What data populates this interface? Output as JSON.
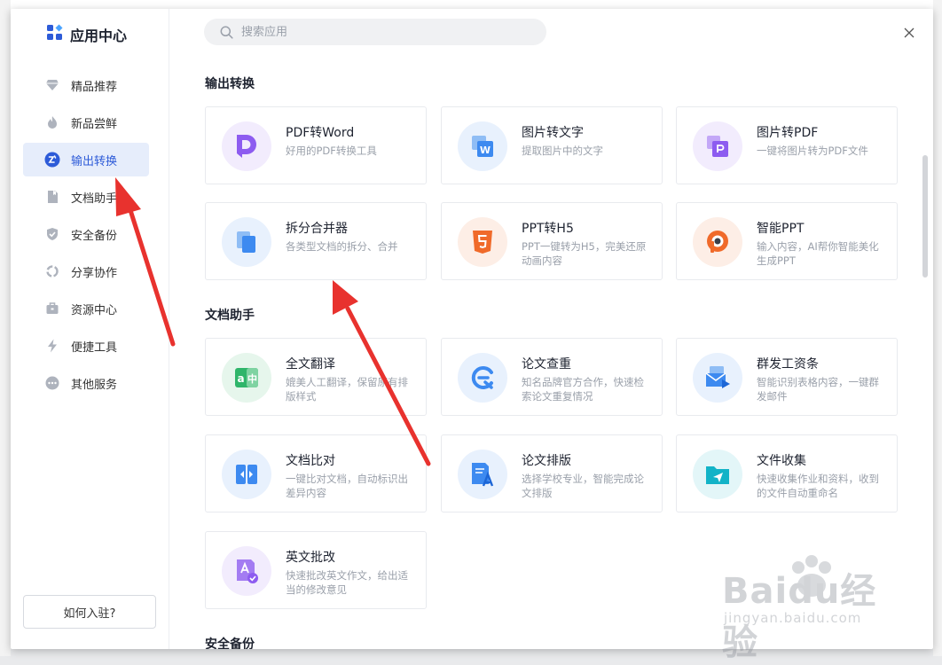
{
  "app": {
    "title": "应用中心"
  },
  "search": {
    "placeholder": "搜索应用"
  },
  "sidebar": {
    "items": [
      {
        "label": "精品推荐",
        "icon": "diamond-icon"
      },
      {
        "label": "新品尝鲜",
        "icon": "flame-icon"
      },
      {
        "label": "输出转换",
        "icon": "convert-icon",
        "active": true
      },
      {
        "label": "文档助手",
        "icon": "document-icon"
      },
      {
        "label": "安全备份",
        "icon": "shield-icon"
      },
      {
        "label": "分享协作",
        "icon": "share-icon"
      },
      {
        "label": "资源中心",
        "icon": "briefcase-icon"
      },
      {
        "label": "便捷工具",
        "icon": "lightning-icon"
      },
      {
        "label": "其他服务",
        "icon": "more-icon"
      }
    ],
    "join_label": "如何入驻?"
  },
  "sections": [
    {
      "title": "输出转换",
      "apps": [
        {
          "title": "PDF转Word",
          "desc": "好用的PDF转换工具",
          "icon": "pdf-to-word-icon"
        },
        {
          "title": "图片转文字",
          "desc": "提取图片中的文字",
          "icon": "image-to-text-icon"
        },
        {
          "title": "图片转PDF",
          "desc": "一键将图片转为PDF文件",
          "icon": "image-to-pdf-icon"
        },
        {
          "title": "拆分合并器",
          "desc": "各类型文档的拆分、合并",
          "icon": "split-merge-icon"
        },
        {
          "title": "PPT转H5",
          "desc": "PPT一键转为H5，完美还原动画内容",
          "icon": "html5-icon"
        },
        {
          "title": "智能PPT",
          "desc": "输入内容，AI帮你智能美化生成PPT",
          "icon": "smart-ppt-icon"
        }
      ]
    },
    {
      "title": "文档助手",
      "apps": [
        {
          "title": "全文翻译",
          "desc": "媲美人工翻译，保留原有排版样式",
          "icon": "translate-icon"
        },
        {
          "title": "论文查重",
          "desc": "知名品牌官方合作，快速检索论文重复情况",
          "icon": "plagiarism-check-icon"
        },
        {
          "title": "群发工资条",
          "desc": "智能识别表格内容，一键群发邮件",
          "icon": "payslip-mail-icon"
        },
        {
          "title": "文档比对",
          "desc": "一键比对文档，自动标识出差异内容",
          "icon": "compare-icon"
        },
        {
          "title": "论文排版",
          "desc": "选择学校专业，智能完成论文排版",
          "icon": "thesis-format-icon"
        },
        {
          "title": "文件收集",
          "desc": "快速收集作业和资料，收到的文件自动重命名",
          "icon": "file-collect-icon"
        },
        {
          "title": "英文批改",
          "desc": "快速批改英文作文，给出适当的修改意见",
          "icon": "english-correct-icon"
        }
      ]
    },
    {
      "title": "安全备份",
      "apps": []
    }
  ],
  "watermark": {
    "brand": "Baidu经验",
    "url": "jingyan.baidu.com"
  },
  "colors": {
    "accent": "#2d5bd8",
    "active_bg": "#e6edfb",
    "arrow": "#e8322e"
  }
}
